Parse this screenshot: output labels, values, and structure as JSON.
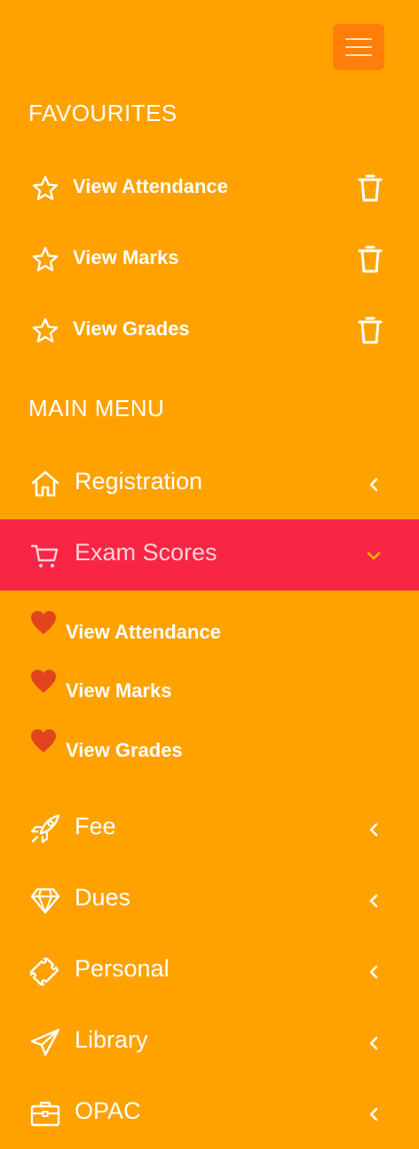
{
  "favourites": {
    "title": "FAVOURITES",
    "items": [
      {
        "label": "View Attendance",
        "icon": "star-icon",
        "action_icon": "trash-icon"
      },
      {
        "label": "View Marks",
        "icon": "star-icon",
        "action_icon": "trash-icon"
      },
      {
        "label": "View Grades",
        "icon": "star-icon",
        "action_icon": "trash-icon"
      }
    ]
  },
  "main_menu": {
    "title": "MAIN MENU",
    "items": [
      {
        "label": "Registration",
        "icon": "home-icon",
        "expanded": false
      },
      {
        "label": "Exam Scores",
        "icon": "cart-icon",
        "expanded": true,
        "sub_items": [
          {
            "label": "View Attendance",
            "icon": "heart-icon"
          },
          {
            "label": "View Marks",
            "icon": "heart-icon"
          },
          {
            "label": "View Grades",
            "icon": "heart-icon"
          }
        ]
      },
      {
        "label": "Fee",
        "icon": "rocket-icon",
        "expanded": false
      },
      {
        "label": "Dues",
        "icon": "diamond-icon",
        "expanded": false
      },
      {
        "label": "Personal",
        "icon": "puzzle-icon",
        "expanded": false
      },
      {
        "label": "Library",
        "icon": "paper-plane-icon",
        "expanded": false
      },
      {
        "label": "OPAC",
        "icon": "briefcase-icon",
        "expanded": false
      }
    ]
  },
  "colors": {
    "background": "#FFA200",
    "toggle_button": "#FF7F0A",
    "active_item": "#F92545",
    "heart": "#E2451E"
  }
}
